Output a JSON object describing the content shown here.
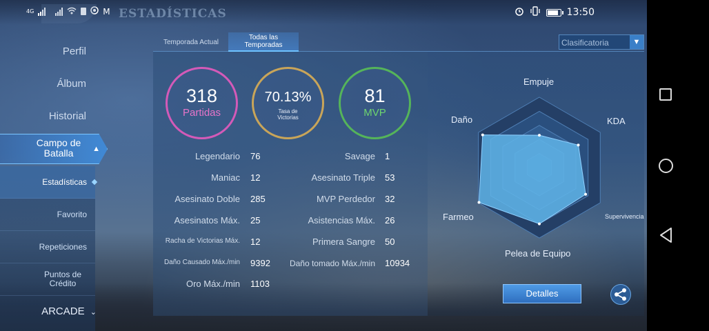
{
  "status_bar": {
    "network": "4G",
    "time": "13:50"
  },
  "header": {
    "title": "ESTADÍSTICAS"
  },
  "sidebar": {
    "items": [
      {
        "label": "Perfil"
      },
      {
        "label": "Álbum"
      },
      {
        "label": "Historial"
      }
    ],
    "campo": {
      "label": "Campo de Batalla"
    },
    "sub_items": [
      {
        "label": "Estadísticas"
      },
      {
        "label": "Favorito"
      },
      {
        "label": "Repeticiones"
      },
      {
        "label": "Puntos de Crédito"
      }
    ],
    "arcade": {
      "label": "ARCADE"
    }
  },
  "tabs": [
    {
      "label": "Temporada Actual"
    },
    {
      "label": "Todas las Temporadas"
    }
  ],
  "dropdown": {
    "selected": "Clasificatoria"
  },
  "circles": {
    "partidas": {
      "value": "318",
      "label": "Partidas"
    },
    "victorias": {
      "value": "70.13%",
      "label": "Tasa de Victorias"
    },
    "mvp": {
      "value": "81",
      "label": "MVP"
    }
  },
  "stats_left": [
    {
      "label": "Legendario",
      "value": "76"
    },
    {
      "label": "Maniac",
      "value": "12"
    },
    {
      "label": "Asesinato Doble",
      "value": "285"
    },
    {
      "label": "Asesinatos Máx.",
      "value": "25"
    },
    {
      "label": "Racha de Victorias Máx.",
      "value": "12"
    },
    {
      "label": "Daño Causado Máx./min",
      "value": "9392"
    },
    {
      "label": "Oro Máx./min",
      "value": "1103"
    }
  ],
  "stats_right": [
    {
      "label": "Savage",
      "value": "1"
    },
    {
      "label": "Asesinato Triple",
      "value": "53"
    },
    {
      "label": "MVP Perdedor",
      "value": "32"
    },
    {
      "label": "Asistencias Máx.",
      "value": "26"
    },
    {
      "label": "Primera Sangre",
      "value": "50"
    },
    {
      "label": "Daño tomado Máx./min",
      "value": "10934"
    }
  ],
  "radar": {
    "labels": {
      "empuje": "Empuje",
      "kda": "KDA",
      "supervivencia": "Supervivencia",
      "pelea": "Pelea de Equipo",
      "farmeo": "Farmeo",
      "dano": "Daño"
    },
    "levels": {
      "empuje": 0.46,
      "kda": 0.64,
      "supervivencia": 0.76,
      "pelea_de_equipo": 0.8,
      "farmeo": 0.99,
      "dano": 0.93
    }
  },
  "buttons": {
    "detalles": "Detalles"
  },
  "colors": {
    "partidas": "#d45ab8",
    "victorias": "#c9a559",
    "mvp": "#55b45a",
    "radar_fill": "#5fb4e8"
  }
}
